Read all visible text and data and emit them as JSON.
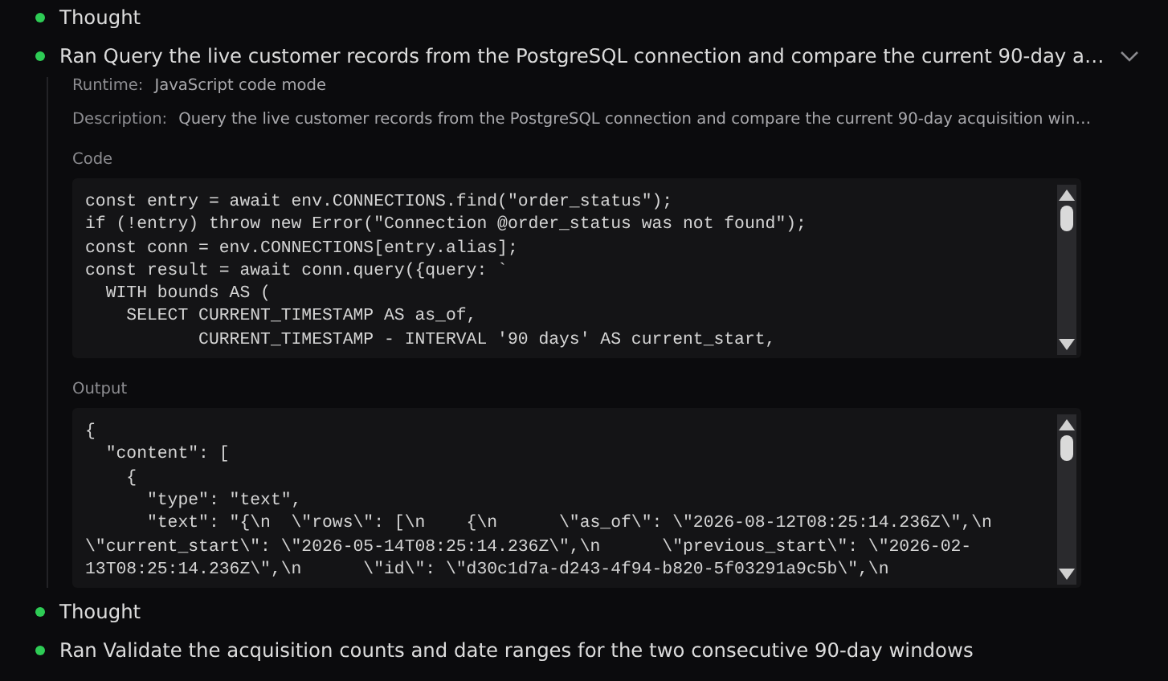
{
  "items": [
    {
      "kind": "thought",
      "label": "Thought"
    },
    {
      "kind": "tool",
      "label": "Ran Query the live customer records from the PostgreSQL connection and compare the current 90-day a…",
      "expanded": true,
      "runtime_label": "Runtime:",
      "runtime": "JavaScript code mode",
      "description_label": "Description:",
      "description": "Query the live customer records from the PostgreSQL connection and compare the current 90-day acquisition win…",
      "code_label": "Code",
      "code_lines": [
        "const entry = await env.CONNECTIONS.find(\"order_status\");",
        "if (!entry) throw new Error(\"Connection @order_status was not found\");",
        "const conn = env.CONNECTIONS[entry.alias];",
        "const result = await conn.query({query: `",
        "  WITH bounds AS (",
        "    SELECT CURRENT_TIMESTAMP AS as_of,",
        "           CURRENT_TIMESTAMP - INTERVAL '90 days' AS current_start,"
      ],
      "output_label": "Output",
      "output_lines": [
        "{",
        "  \"content\": [",
        "    {",
        "      \"type\": \"text\",",
        "      \"text\": \"{\\n  \\\"rows\\\": [\\n    {\\n      \\\"as_of\\\": \\\"2026-08-12T08:25:14.236Z\\\",\\n",
        "\\\"current_start\\\": \\\"2026-05-14T08:25:14.236Z\\\",\\n      \\\"previous_start\\\": \\\"2026-02-",
        "13T08:25:14.236Z\\\",\\n      \\\"id\\\": \\\"d30c1d7a-d243-4f94-b820-5f03291a9c5b\\\",\\n"
      ]
    },
    {
      "kind": "thought",
      "label": "Thought"
    },
    {
      "kind": "tool",
      "label": "Ran Validate the acquisition counts and date ranges for the two consecutive 90-day windows"
    }
  ]
}
